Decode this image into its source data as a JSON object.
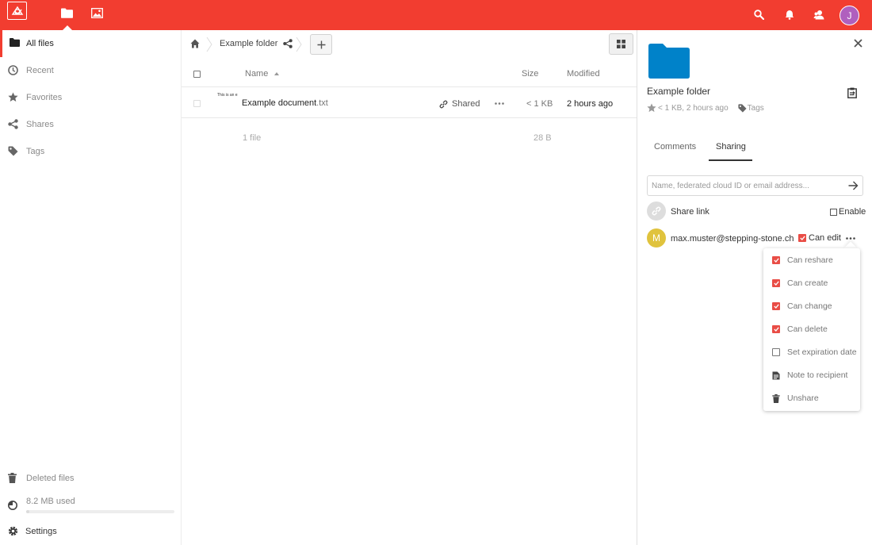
{
  "colors": {
    "brand": "#f23d30",
    "checkbox_checked": "#e94d46",
    "folder": "#0082c9"
  },
  "header": {
    "apps": [
      {
        "name": "Files",
        "icon": "folder-icon",
        "active": true
      },
      {
        "name": "Gallery",
        "icon": "image-icon",
        "active": false
      }
    ],
    "avatar_initial": "J"
  },
  "sidebar": {
    "items": [
      {
        "label": "All files",
        "icon": "folder-icon",
        "active": true
      },
      {
        "label": "Recent",
        "icon": "clock-icon"
      },
      {
        "label": "Favorites",
        "icon": "star-icon"
      },
      {
        "label": "Shares",
        "icon": "share-icon"
      },
      {
        "label": "Tags",
        "icon": "tag-icon"
      }
    ],
    "deleted_label": "Deleted files",
    "quota_label": "8.2 MB used",
    "settings_label": "Settings"
  },
  "breadcrumb": {
    "folder": "Example folder"
  },
  "table": {
    "headers": {
      "name": "Name",
      "size": "Size",
      "modified": "Modified"
    },
    "rows": [
      {
        "thumb_text": "This is an example",
        "basename": "Example document",
        "ext": ".txt",
        "shared_label": "Shared",
        "size": "< 1 KB",
        "modified": "2 hours ago"
      }
    ],
    "summary": {
      "count": "1 file",
      "size": "28 B"
    }
  },
  "details": {
    "title": "Example folder",
    "meta": "< 1 KB, 2 hours ago",
    "tags_label": "Tags",
    "tabs": [
      {
        "label": "Comments",
        "active": false
      },
      {
        "label": "Sharing",
        "active": true
      }
    ],
    "share_input_placeholder": "Name, federated cloud ID or email address...",
    "share_link_label": "Share link",
    "enable_label": "Enable",
    "share": {
      "initial": "M",
      "email": "max.muster@stepping-stone.ch",
      "can_edit_label": "Can edit"
    },
    "permissions_menu": [
      {
        "label": "Can reshare",
        "checked": true
      },
      {
        "label": "Can create",
        "checked": true
      },
      {
        "label": "Can change",
        "checked": true
      },
      {
        "label": "Can delete",
        "checked": true
      },
      {
        "label": "Set expiration date",
        "checked": false
      },
      {
        "label": "Note to recipient",
        "icon": "note-icon"
      },
      {
        "label": "Unshare",
        "icon": "trash-icon"
      }
    ]
  }
}
